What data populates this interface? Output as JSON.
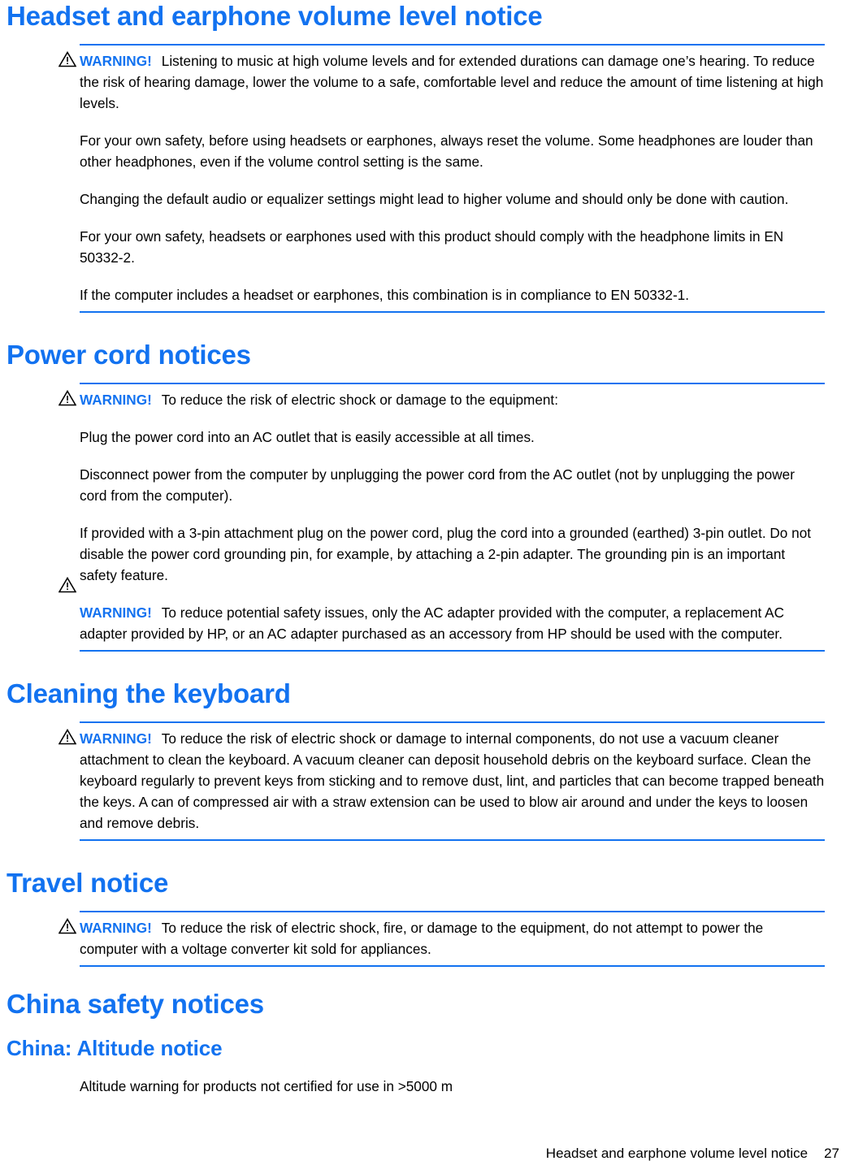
{
  "colors": {
    "heading_blue": "#1272f0",
    "rule_blue": "#1272f0",
    "body_text": "#000000",
    "page_background": "#ffffff"
  },
  "sections": [
    {
      "id": "headset-earphone-volume",
      "title": "Headset and earphone volume level notice",
      "warning_label": "WARNING!",
      "warning_text": "Listening to music at high volume levels and for extended durations can damage one’s hearing. To reduce the risk of hearing damage, lower the volume to a safe, comfortable level and reduce the amount of time listening at high levels.",
      "paragraphs": [
        "For your own safety, before using headsets or earphones, always reset the volume. Some headphones are louder than other headphones, even if the volume control setting is the same.",
        "Changing the default audio or equalizer settings might lead to higher volume and should only be done with caution.",
        "For your own safety, headsets or earphones used with this product should comply with the headphone limits in EN 50332-2.",
        "If the computer includes a headset or earphones, this combination is in compliance to EN 50332-1."
      ]
    },
    {
      "id": "power-cord-notices",
      "title": "Power cord notices",
      "warning_label": "WARNING!",
      "warning_text": "To reduce the risk of electric shock or damage to the equipment:",
      "paragraphs": [
        "Plug the power cord into an AC outlet that is easily accessible at all times.",
        "Disconnect power from the computer by unplugging the power cord from the AC outlet (not by unplugging the power cord from the computer).",
        "If provided with a 3-pin attachment plug on the power cord, plug the cord into a grounded (earthed) 3-pin outlet. Do not disable the power cord grounding pin, for example, by attaching a 2-pin adapter. The grounding pin is an important safety feature."
      ],
      "warning_label_2": "WARNING!",
      "warning_text_2": "To reduce potential safety issues, only the AC adapter provided with the computer, a replacement AC adapter provided by HP, or an AC adapter purchased as an accessory from HP should be used with the computer."
    },
    {
      "id": "cleaning-the-keyboard",
      "title": "Cleaning the keyboard",
      "warning_label": "WARNING!",
      "warning_text": "To reduce the risk of electric shock or damage to internal components, do not use a vacuum cleaner attachment to clean the keyboard. A vacuum cleaner can deposit household debris on the keyboard surface. Clean the keyboard regularly to prevent keys from sticking and to remove dust, lint, and particles that can become trapped beneath the keys. A can of compressed air with a straw extension can be used to blow air around and under the keys to loosen and remove debris."
    },
    {
      "id": "travel-notice",
      "title": "Travel notice",
      "warning_label": "WARNING!",
      "warning_text": "To reduce the risk of electric shock, fire, or damage to the equipment, do not attempt to power the computer with a voltage converter kit sold for appliances."
    },
    {
      "id": "china-safety-notices",
      "title": "China safety notices",
      "subtitle": "China: Altitude notice",
      "paragraphs": [
        "Altitude warning for products not certified for use in >5000 m"
      ]
    }
  ],
  "footer": {
    "running_title": "Headset and earphone volume level notice",
    "page_number": "27"
  }
}
